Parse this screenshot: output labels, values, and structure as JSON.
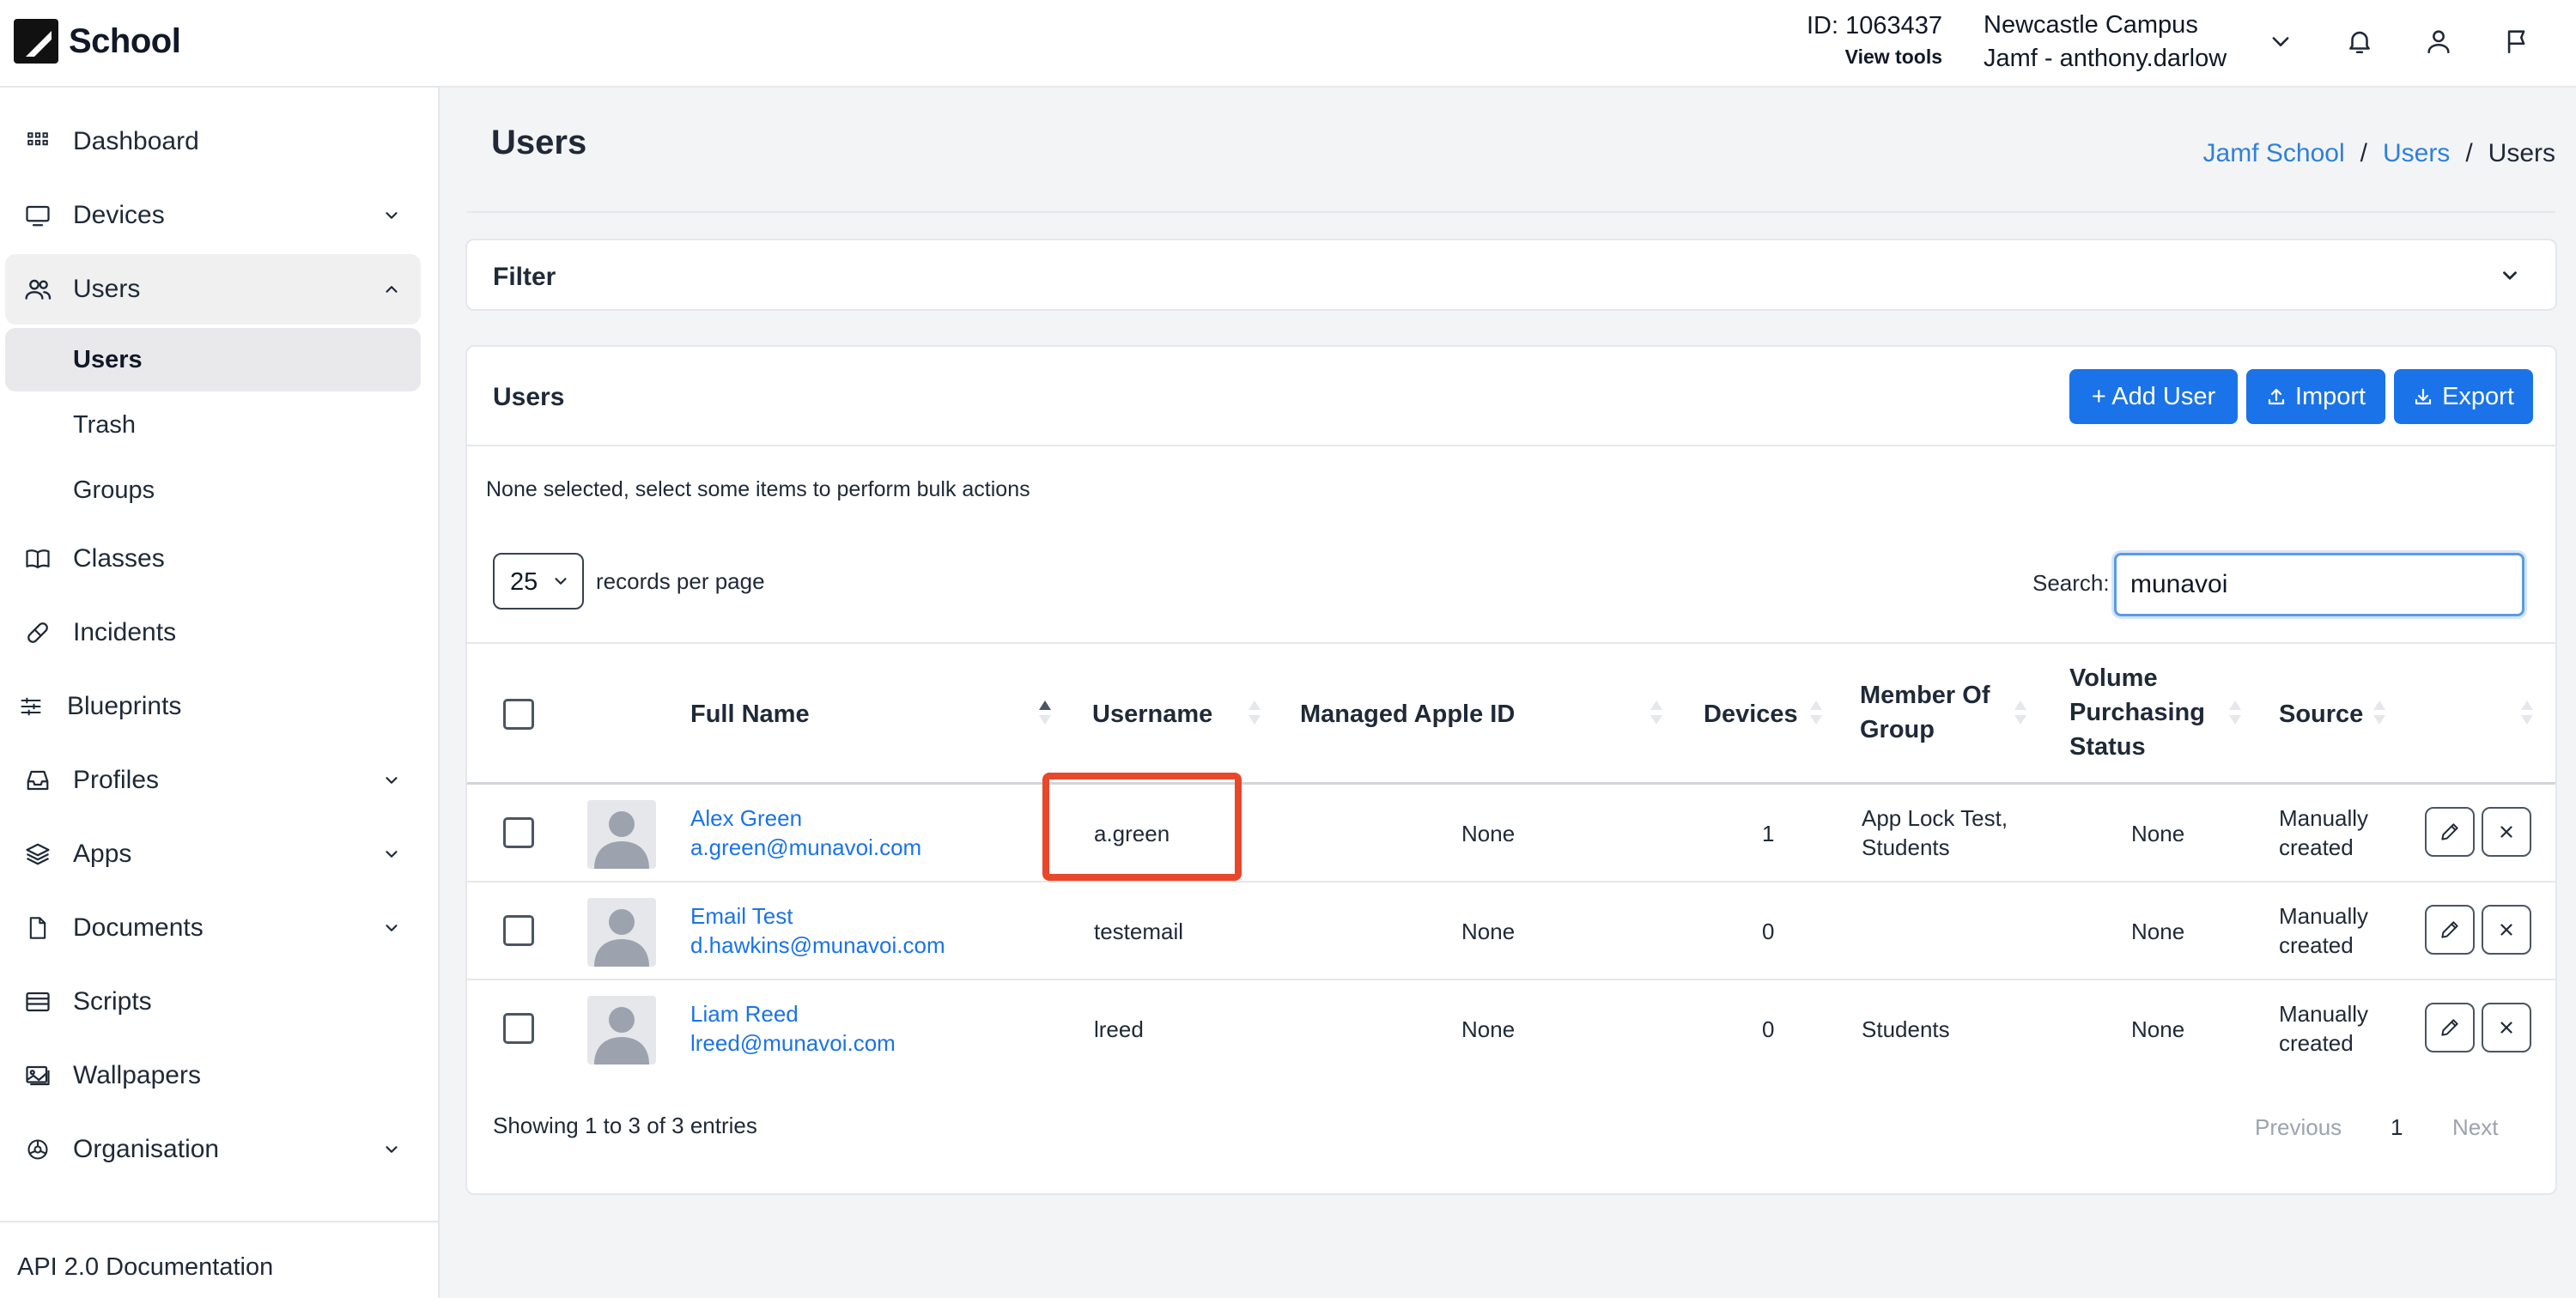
{
  "app": {
    "name": "School",
    "id_label": "ID: 1063437",
    "view_tools": "View tools",
    "campus": "Newcastle Campus",
    "account": "Jamf - anthony.darlow"
  },
  "icons": {
    "logo": "jamf-logo-icon",
    "bell": "bell-icon",
    "user": "user-icon",
    "flag": "flag-icon"
  },
  "sidebar": {
    "items": [
      {
        "label": "Dashboard",
        "icon": "dashboard-icon"
      },
      {
        "label": "Devices",
        "icon": "monitor-icon"
      },
      {
        "label": "Users",
        "icon": "users-icon"
      },
      {
        "label": "Classes",
        "icon": "book-icon"
      },
      {
        "label": "Incidents",
        "icon": "pill-icon"
      },
      {
        "label": "Blueprints",
        "icon": "sliders-icon"
      },
      {
        "label": "Profiles",
        "icon": "inbox-icon"
      },
      {
        "label": "Apps",
        "icon": "layers-icon"
      },
      {
        "label": "Documents",
        "icon": "document-icon"
      },
      {
        "label": "Scripts",
        "icon": "window-icon"
      },
      {
        "label": "Wallpapers",
        "icon": "image-icon"
      },
      {
        "label": "Organisation",
        "icon": "organisation-icon"
      }
    ],
    "users_sub": [
      "Users",
      "Trash",
      "Groups"
    ],
    "footer": "API 2.0 Documentation"
  },
  "page": {
    "title": "Users",
    "breadcrumb": [
      "Jamf School",
      "/",
      "Users",
      "/",
      "Users"
    ]
  },
  "filter": {
    "title": "Filter"
  },
  "users_card": {
    "title": "Users",
    "add_user": "+ Add User",
    "import": "Import",
    "export": "Export",
    "bulk_text": "None selected, select some items to perform bulk actions",
    "page_size": "25",
    "records_per_page": "records per page",
    "search_label": "Search:",
    "search_value": "munavoi",
    "search_placeholder": ""
  },
  "table": {
    "headers": {
      "full_name": "Full Name",
      "username": "Username",
      "managed_apple_id": "Managed Apple ID",
      "devices": "Devices",
      "member_of_group_1": "Member Of",
      "member_of_group_2": "Group",
      "vpp_1": "Volume",
      "vpp_2": "Purchasing",
      "vpp_3": "Status",
      "source": "Source"
    },
    "rows": [
      {
        "name": "Alex Green",
        "email": "a.green@munavoi.com",
        "username": "a.green",
        "apple_id": "None",
        "devices": "1",
        "group_1": "App Lock Test,",
        "group_2": "Students",
        "vpp": "None",
        "source_1": "Manually",
        "source_2": "created"
      },
      {
        "name": "Email Test",
        "email": "d.hawkins@munavoi.com",
        "username": "testemail",
        "apple_id": "None",
        "devices": "0",
        "group_1": "",
        "group_2": "",
        "vpp": "None",
        "source_1": "Manually",
        "source_2": "created"
      },
      {
        "name": "Liam Reed",
        "email": "lreed@munavoi.com",
        "username": "lreed",
        "apple_id": "None",
        "devices": "0",
        "group_1": "Students",
        "group_2": "",
        "vpp": "None",
        "source_1": "Manually",
        "source_2": "created"
      }
    ],
    "showing": "Showing 1 to 3 of 3 entries",
    "pager": {
      "previous": "Previous",
      "page": "1",
      "next": "Next"
    }
  },
  "colors": {
    "accent": "#1a73e8",
    "link": "#2f80d9",
    "highlight": "#e8472a"
  }
}
